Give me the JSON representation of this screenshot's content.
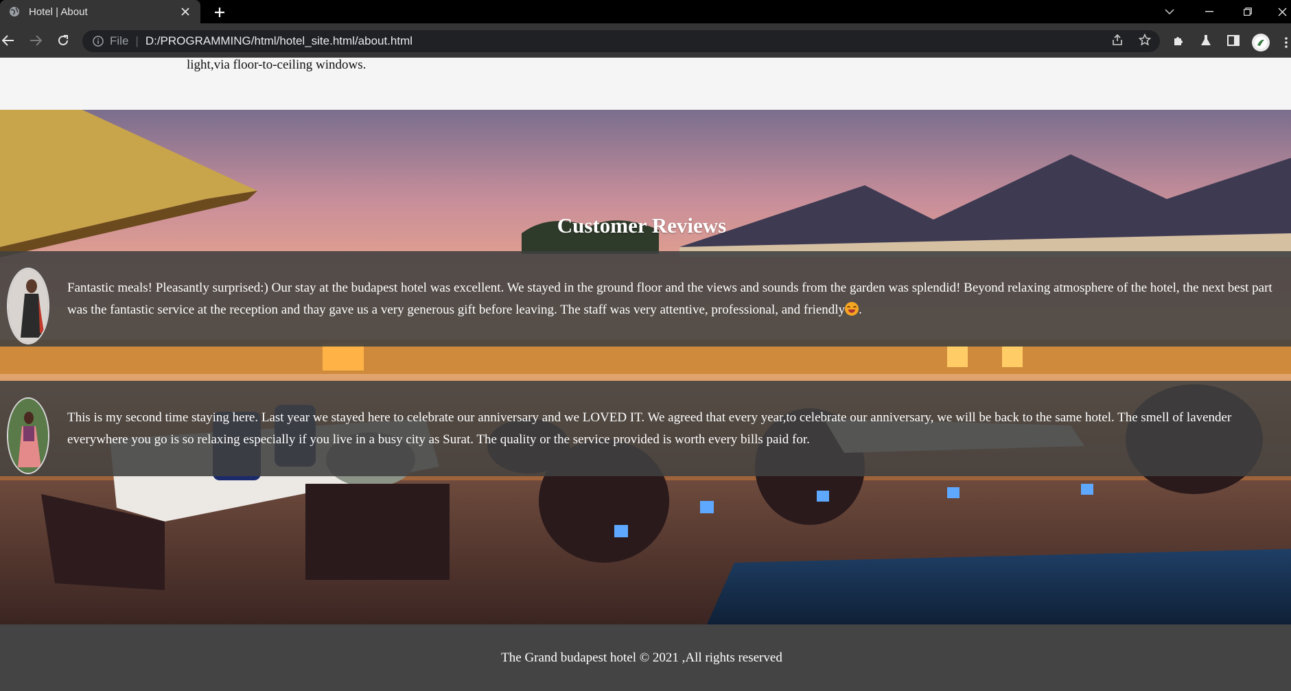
{
  "browser": {
    "tab_title": "Hotel | About",
    "scheme_label": "File",
    "url": "D:/PROGRAMMING/html/hotel_site.html/about.html"
  },
  "page": {
    "intro_tail": "light,via floor-to-ceiling windows.",
    "reviews_title": "Customer Reviews",
    "reviews": [
      {
        "text": "Fantastic meals! Pleasantly surprised:) Our stay at the budapest hotel was excellent. We stayed in the ground floor and the views and sounds from the garden was splendid! Beyond relaxing atmosphere of the hotel, the next best part was the fantastic service at the reception and thay gave us a very generous gift before leaving. The staff was very attentive, professional, and friendly",
        "text_end": "."
      },
      {
        "text": "This is my second time staying here. Last year we stayed here to celebrate our anniversary and we LOVED IT. We agreed that every year,to celebrate our anniversary, we will be back to the same hotel. The smell of lavender everywhere you go is so relaxing especially if you live in a busy city as Surat. The quality or the service provided is worth every bills paid for."
      }
    ],
    "footer": "The Grand budapest hotel © 2021 ,All rights reserved"
  }
}
